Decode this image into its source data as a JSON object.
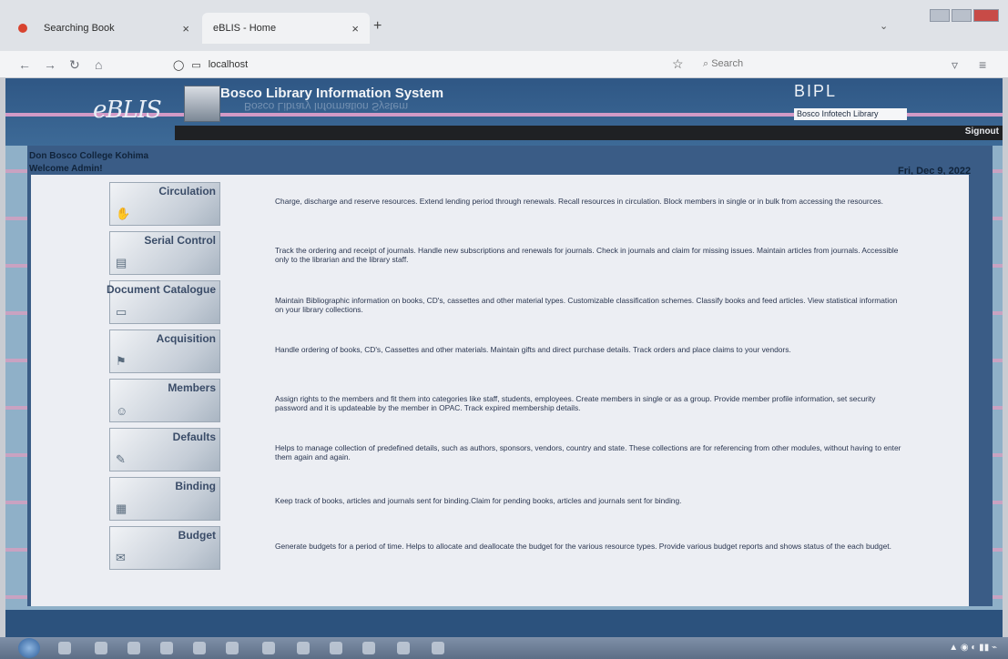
{
  "browser": {
    "tabs": [
      {
        "title": "Searching Book",
        "close": "×"
      },
      {
        "title": "eBLIS - Home",
        "close": "×"
      }
    ],
    "new_tab": "+",
    "url": "localhost",
    "search_placeholder": "Search"
  },
  "header": {
    "logo": "eBLIS",
    "system_title": "Bosco Library Information System",
    "brand": "BIPL",
    "brand_sub": "Bosco Infotech Library",
    "signout": "Signout"
  },
  "info": {
    "college": "Don Bosco College Kohima",
    "welcome": "Welcome Admin!",
    "date": "Fri, Dec 9, 2022"
  },
  "modules": [
    {
      "label": "Circulation",
      "icon": "hand-icon",
      "desc": "Charge, discharge and reserve resources. Extend lending period through renewals. Recall resources in circulation. Block members in single or in bulk from accessing the resources."
    },
    {
      "label": "Serial Control",
      "icon": "journal-icon",
      "desc": "Track the ordering and receipt of journals. Handle new subscriptions and renewals for journals. Check in journals and claim for missing issues. Maintain articles from journals. Accessible only to the librarian and the library staff."
    },
    {
      "label": "Document Catalogue",
      "icon": "catalogue-icon",
      "desc": "Maintain Bibliographic information on books, CD's, cassettes and other material types. Customizable classification schemes. Classify books and feed articles. View statistical information on your library collections."
    },
    {
      "label": "Acquisition",
      "icon": "acquisition-icon",
      "desc": "Handle ordering of books, CD's, Cassettes and other materials. Maintain gifts and direct purchase details. Track orders and place claims to your vendors."
    },
    {
      "label": "Members",
      "icon": "members-icon",
      "desc": "Assign rights to the members and fit them into categories like staff, students, employees. Create members in single or as a group. Provide member profile information, set security password and it is updateable by the member in OPAC. Track expired membership details."
    },
    {
      "label": "Defaults",
      "icon": "pen-icon",
      "desc": "Helps to manage collection of predefined details, such as authors, sponsors, vendors, country and state. These collections are for referencing from other modules, without having to enter them again and again."
    },
    {
      "label": "Binding",
      "icon": "binding-icon",
      "desc": "Keep track of books, articles and journals sent for binding.Claim for pending books, articles and journals sent for binding."
    },
    {
      "label": "Budget",
      "icon": "budget-icon",
      "desc": "Generate budgets for a period of time. Helps to allocate and deallocate the budget for the various resource types. Provide various budget reports and shows status of the each budget."
    }
  ]
}
